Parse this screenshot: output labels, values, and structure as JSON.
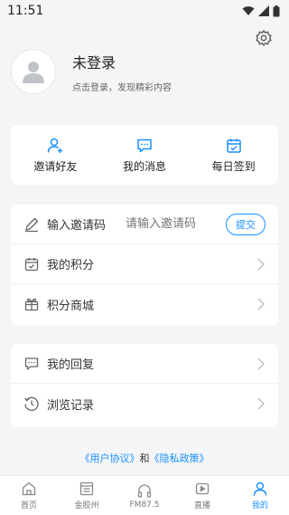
{
  "status": {
    "time": "11:51"
  },
  "profile": {
    "title": "未登录",
    "subtitle": "点击登录，发现精彩内容"
  },
  "quick_actions": [
    {
      "label": "邀请好友",
      "icon": "invite-user-icon"
    },
    {
      "label": "我的消息",
      "icon": "message-icon"
    },
    {
      "label": "每日签到",
      "icon": "calendar-check-icon"
    }
  ],
  "invite": {
    "label": "输入邀请码",
    "placeholder": "请输入邀请码",
    "submit": "提交"
  },
  "list1": [
    {
      "label": "我的积分",
      "icon": "points-icon"
    },
    {
      "label": "积分商城",
      "icon": "gift-icon"
    }
  ],
  "list2": [
    {
      "label": "我的回复",
      "icon": "reply-icon"
    },
    {
      "label": "浏览记录",
      "icon": "history-icon"
    }
  ],
  "agreement": {
    "user": "《用户协议》",
    "and": "和",
    "privacy": "《隐私政策》"
  },
  "tabs": [
    {
      "label": "首页",
      "icon": "home-icon"
    },
    {
      "label": "金胶州",
      "icon": "news-icon"
    },
    {
      "label": "FM87.5",
      "icon": "headphones-icon"
    },
    {
      "label": "直播",
      "icon": "live-icon"
    },
    {
      "label": "我的",
      "icon": "profile-icon",
      "active": true
    }
  ],
  "colors": {
    "accent": "#1890ff",
    "background": "#f4f5f6"
  }
}
